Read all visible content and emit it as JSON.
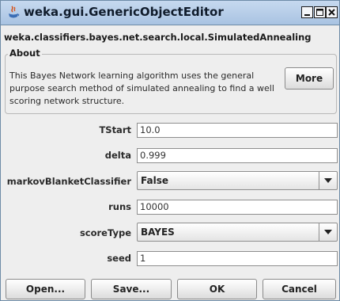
{
  "window": {
    "title": "weka.gui.GenericObjectEditor",
    "icons": {
      "app": "java-icon",
      "minimize": "minimize-icon",
      "maximize": "maximize-icon",
      "close": "close-icon"
    }
  },
  "class_name": "weka.classifiers.bayes.net.search.local.SimulatedAnnealing",
  "about": {
    "title": "About",
    "text": "This Bayes Network learning algorithm uses the general purpose search method of simulated annealing to find a well scoring network structure.",
    "more_label": "More"
  },
  "properties": [
    {
      "label": "TStart",
      "value": "10.0"
    },
    {
      "label": "delta",
      "value": "0.999"
    },
    {
      "label": "markovBlanketClassifier",
      "value": "False",
      "control": "dropdown"
    },
    {
      "label": "runs",
      "value": "10000"
    },
    {
      "label": "scoreType",
      "value": "BAYES",
      "control": "dropdown"
    },
    {
      "label": "seed",
      "value": "1"
    }
  ],
  "buttons": {
    "open": "Open...",
    "save": "Save...",
    "ok": "OK",
    "cancel": "Cancel"
  },
  "colors": {
    "title_bar": "#b8cee8",
    "background": "#eeeeee",
    "border": "#8e8e8e"
  }
}
